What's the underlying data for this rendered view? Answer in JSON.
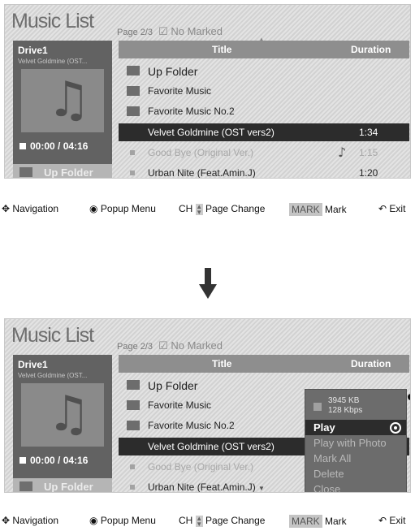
{
  "screen_before": {
    "title": "Music List",
    "page_info": "Page 2/3",
    "marked": "☑ No Marked",
    "drive": "Drive1",
    "drive_file": "Velvet Goldmine (OST...",
    "time": "00:00 / 04:16",
    "up_folder_button": "Up Folder",
    "col_title": "Title",
    "col_duration": "Duration",
    "rows": [
      {
        "name": "Up Folder",
        "duration": ""
      },
      {
        "name": "Favorite Music",
        "duration": ""
      },
      {
        "name": "Favorite Music No.2",
        "duration": ""
      },
      {
        "name": "Velvet Goldmine (OST vers2)",
        "duration": "1:34"
      },
      {
        "name": "Good Bye (Original Ver.)",
        "duration": "1:15"
      },
      {
        "name": "Urban Nite (Feat.Amin.J)",
        "duration": "1:20"
      }
    ]
  },
  "screen_after": {
    "title": "Music List",
    "page_info": "Page 2/3",
    "marked": "☑ No Marked",
    "drive": "Drive1",
    "drive_file": "Velvet Goldmine (OST...",
    "time": "00:00 / 04:16",
    "up_folder_button": "Up Folder",
    "col_title": "Title",
    "col_duration": "Duration",
    "rows": [
      {
        "name": "Up Folder"
      },
      {
        "name": "Favorite Music"
      },
      {
        "name": "Favorite Music No.2"
      },
      {
        "name": "Velvet Goldmine (OST vers2)"
      },
      {
        "name": "Good Bye (Original Ver.)"
      },
      {
        "name": "Urban Nite (Feat.Amin.J)"
      }
    ],
    "popup": {
      "size": "3945 KB",
      "bitrate": "128 Kbps",
      "items": [
        "Play",
        "Play with Photo",
        "Mark All",
        "Delete",
        "Close"
      ]
    }
  },
  "help_bar": {
    "navigation": "Navigation",
    "popup_menu": "Popup Menu",
    "ch": "CH",
    "page_change": "Page Change",
    "mark_key": "MARK",
    "mark": "Mark",
    "exit": "Exit"
  },
  "icons": {
    "folder": "folder-icon",
    "music_file": "music-file-icon",
    "note": "music-note-icon",
    "navigation": "navigation-cross-icon",
    "popup": "circle-button-icon",
    "exit": "return-icon",
    "transition": "down-arrow-icon"
  }
}
